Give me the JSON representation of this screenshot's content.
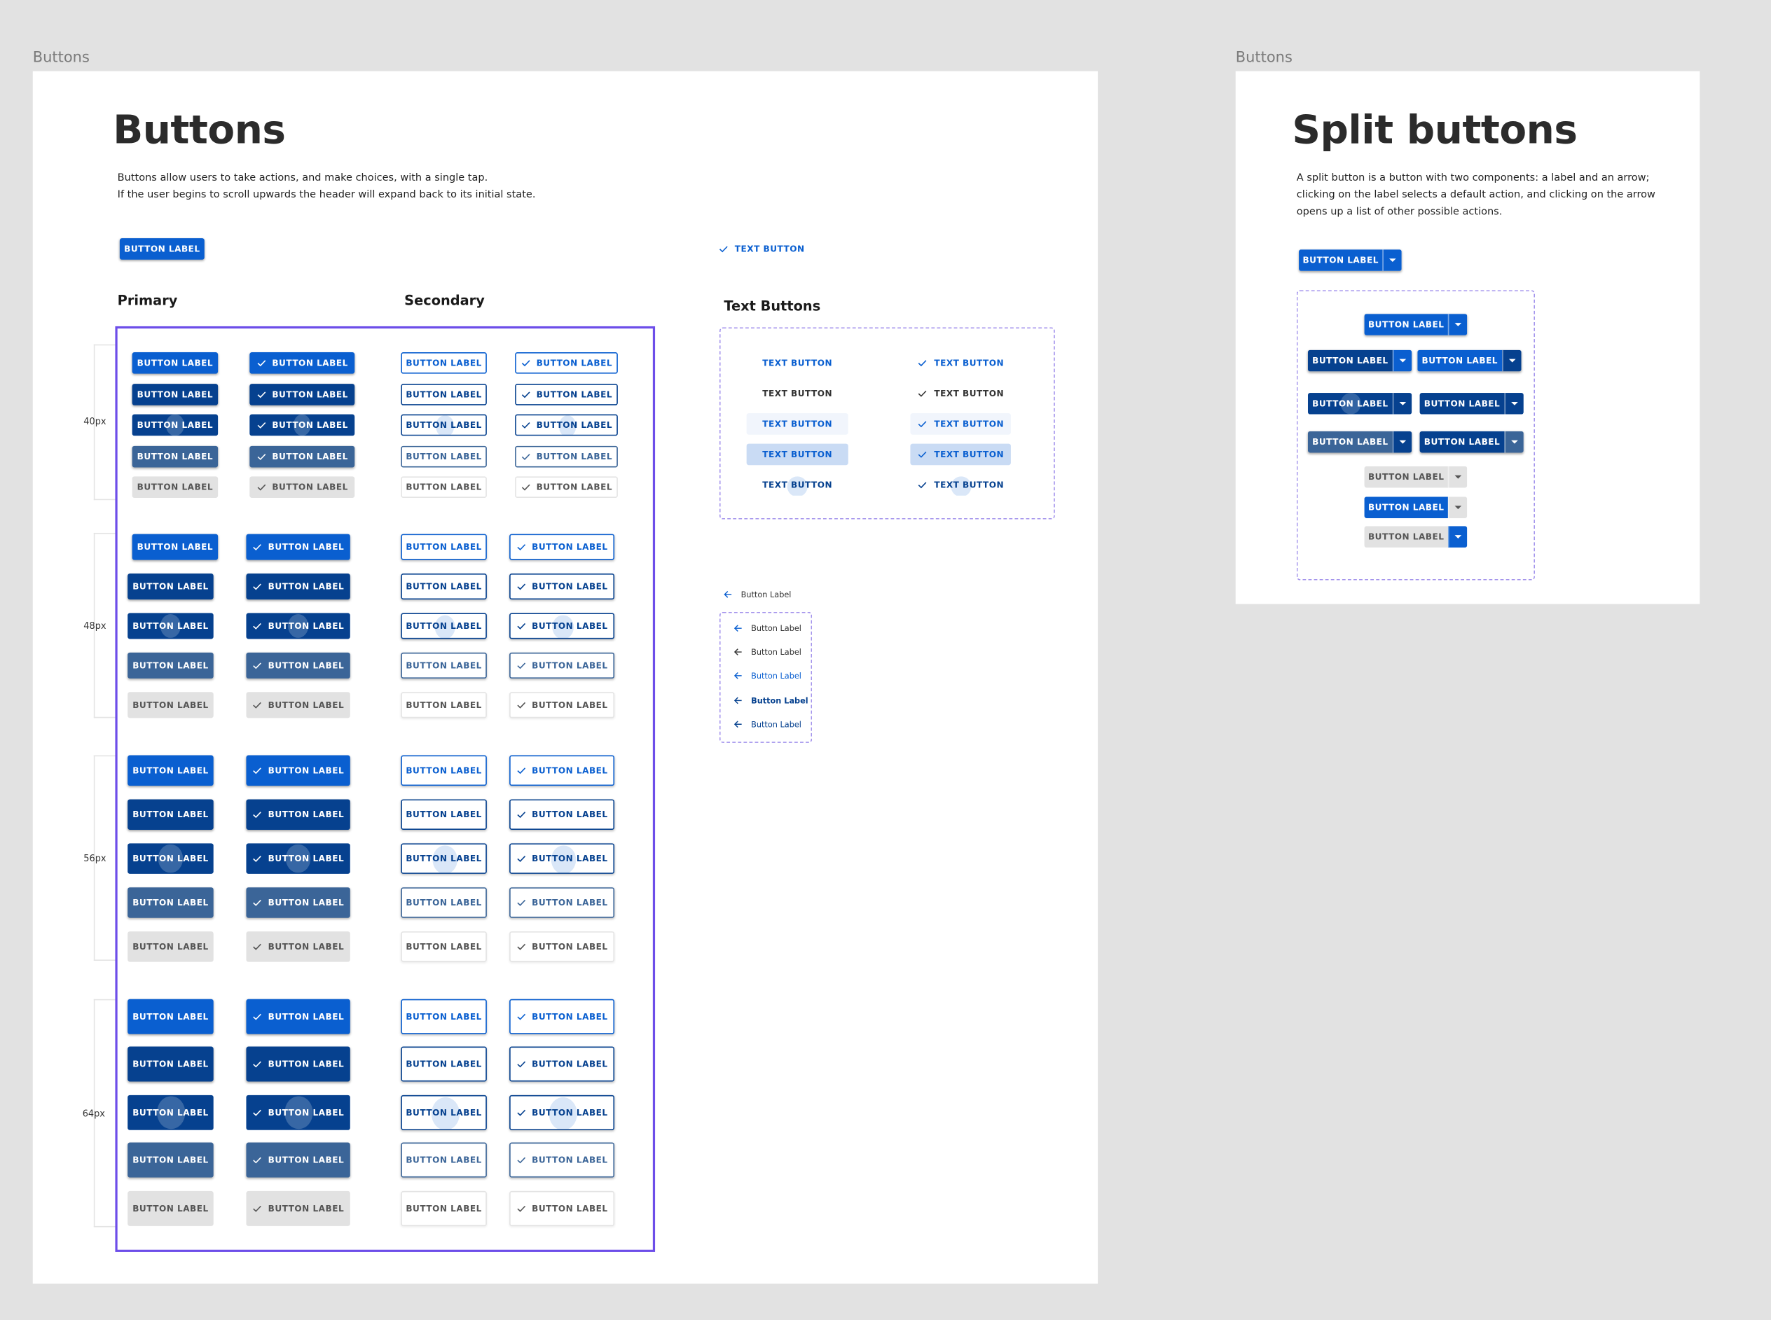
{
  "frames": {
    "left_label": "Buttons",
    "right_label": "Buttons"
  },
  "buttons_page": {
    "title": "Buttons",
    "description_line1": "Buttons allow users to take actions, and make choices, with a single tap.",
    "description_line2": "If the user begins to scroll upwards the header will expand back to its initial state.",
    "sample_button": "BUTTON LABEL",
    "sample_text_button": "TEXT BUTTON",
    "primary_heading": "Primary",
    "secondary_heading": "Secondary",
    "text_buttons_heading": "Text Buttons",
    "button_label": "BUTTON LABEL",
    "text_button_label": "TEXT BUTTON",
    "back_button_label": "Button Label",
    "size_groups": [
      "40px",
      "48px",
      "56px",
      "64px"
    ],
    "states": [
      "enabled",
      "hover",
      "focus",
      "pressed",
      "disabled"
    ]
  },
  "split_page": {
    "title": "Split buttons",
    "description_line1": "A split button is a button with two components: a label and an arrow;",
    "description_line2": "clicking on the label selects a default action, and clicking on the arrow",
    "description_line3": "opens up a list of other possible actions.",
    "button_label": "BUTTON LABEL"
  },
  "colors": {
    "primary": "#0a5fd0",
    "primary_dark": "#06418f",
    "pressed": "#3b6598",
    "disabled": "#e2e2e2",
    "selection_outline": "#6d4ee9",
    "dashed_outline": "#a393ec"
  },
  "icons": [
    "check-icon",
    "chevron-down-icon",
    "arrow-left-icon"
  ]
}
